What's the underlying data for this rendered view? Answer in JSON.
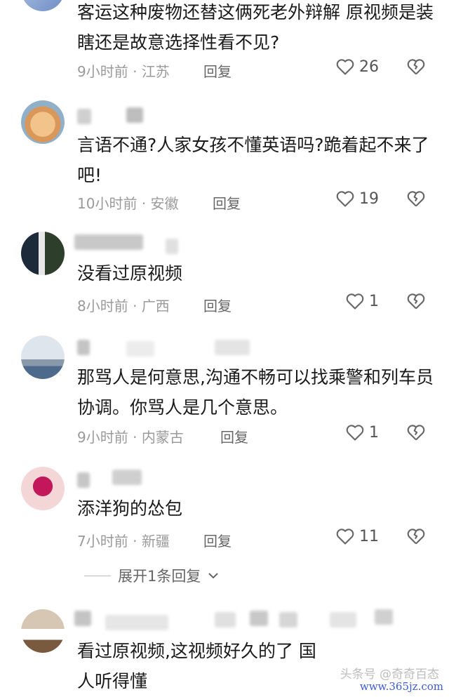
{
  "comments": [
    {
      "text": "客运这种废物还替这俩死老外辩解 原视频是装瞎还是故意选择性看不见?",
      "time": "9小时前",
      "location": "江苏",
      "reply": "回复",
      "likes": "26"
    },
    {
      "text": "言语不通?人家女孩不懂英语吗?跪着起不来了吧!",
      "time": "10小时前",
      "location": "安徽",
      "reply": "回复",
      "likes": "19"
    },
    {
      "text": "没看过原视频",
      "time": "8小时前",
      "location": "广西",
      "reply": "回复",
      "likes": "1"
    },
    {
      "text": "那骂人是何意思,沟通不畅可以找乘警和列车员协调。你骂人是几个意思。",
      "time": "9小时前",
      "location": "内蒙古",
      "reply": "回复",
      "likes": "1"
    },
    {
      "text": "添洋狗的怂包",
      "time": "7小时前",
      "location": "新疆",
      "reply": "回复",
      "likes": "11"
    },
    {
      "text": "看过原视频,这视频好久的了 国人听得懂"
    }
  ],
  "expand_label": "展开1条回复",
  "watermark": "www.365jz.com",
  "watermark_faded": "头条号 @奇奇百态",
  "separator": "·"
}
